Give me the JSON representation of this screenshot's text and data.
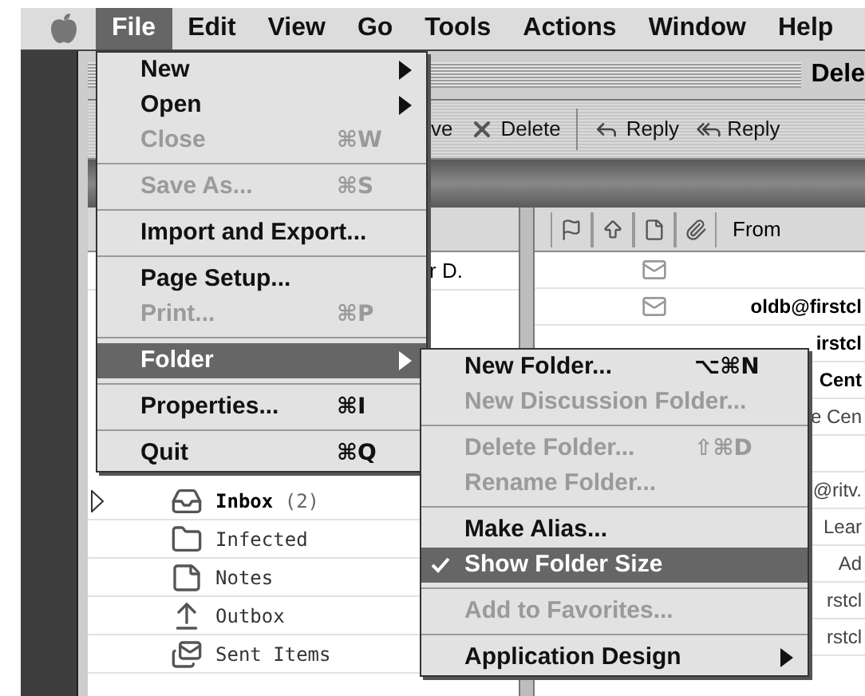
{
  "menubar": {
    "items": [
      {
        "label": "File",
        "selected": true
      },
      {
        "label": "Edit",
        "selected": false
      },
      {
        "label": "View",
        "selected": false
      },
      {
        "label": "Go",
        "selected": false
      },
      {
        "label": "Tools",
        "selected": false
      },
      {
        "label": "Actions",
        "selected": false
      },
      {
        "label": "Window",
        "selected": false
      },
      {
        "label": "Help",
        "selected": false
      }
    ]
  },
  "file_menu": {
    "groups": [
      [
        {
          "label": "New",
          "disabled": false,
          "submenu": true,
          "selected": false
        },
        {
          "label": "Open",
          "disabled": false,
          "submenu": true,
          "selected": false
        },
        {
          "label": "Close",
          "shortcut": "⌘W",
          "disabled": true,
          "submenu": false,
          "selected": false
        }
      ],
      [
        {
          "label": "Save As...",
          "shortcut": "⌘S",
          "disabled": true,
          "submenu": false,
          "selected": false
        }
      ],
      [
        {
          "label": "Import and Export...",
          "disabled": false,
          "submenu": false,
          "selected": false
        }
      ],
      [
        {
          "label": "Page Setup...",
          "disabled": false,
          "submenu": false,
          "selected": false
        },
        {
          "label": "Print...",
          "shortcut": "⌘P",
          "disabled": true,
          "submenu": false,
          "selected": false
        }
      ],
      [
        {
          "label": "Folder",
          "disabled": false,
          "submenu": true,
          "selected": true
        }
      ],
      [
        {
          "label": "Properties...",
          "shortcut": "⌘I",
          "disabled": false,
          "submenu": false,
          "selected": false
        }
      ],
      [
        {
          "label": "Quit",
          "shortcut": "⌘Q",
          "disabled": false,
          "submenu": false,
          "selected": false
        }
      ]
    ]
  },
  "folder_submenu": {
    "groups": [
      [
        {
          "label": "New Folder...",
          "shortcut": "⌥⌘N",
          "disabled": false,
          "submenu": false,
          "selected": false,
          "checked": false
        },
        {
          "label": "New Discussion Folder...",
          "disabled": true,
          "submenu": false,
          "selected": false,
          "checked": false
        }
      ],
      [
        {
          "label": "Delete Folder...",
          "shortcut": "⇧⌘D",
          "disabled": true,
          "submenu": false,
          "selected": false,
          "checked": false
        },
        {
          "label": "Rename Folder...",
          "disabled": true,
          "submenu": false,
          "selected": false,
          "checked": false
        }
      ],
      [
        {
          "label": "Make Alias...",
          "disabled": false,
          "submenu": false,
          "selected": false,
          "checked": false
        },
        {
          "label": "Show Folder Size",
          "disabled": false,
          "submenu": false,
          "selected": true,
          "checked": true
        }
      ],
      [
        {
          "label": "Add to Favorites...",
          "disabled": true,
          "submenu": false,
          "selected": false,
          "checked": false
        }
      ],
      [
        {
          "label": "Application Design",
          "disabled": false,
          "submenu": true,
          "selected": false,
          "checked": false
        }
      ]
    ]
  },
  "window": {
    "title": "Dele",
    "toolbar": [
      {
        "label": "ve",
        "kind": "plain"
      },
      {
        "label": "Delete",
        "kind": "delete"
      },
      {
        "label": "Reply",
        "kind": "reply"
      },
      {
        "label": "Reply",
        "kind": "reply_all"
      }
    ],
    "folder_list": {
      "top_row_text": "r D.",
      "items": [
        {
          "label": "Inbox",
          "count": "(2)",
          "unread": true,
          "has_children": true
        },
        {
          "label": "Infected",
          "unread": false,
          "has_children": false
        },
        {
          "label": "Notes",
          "unread": false,
          "has_children": false
        },
        {
          "label": "Outbox",
          "unread": false,
          "has_children": false
        },
        {
          "label": "Sent Items",
          "unread": false,
          "has_children": false
        }
      ]
    },
    "message_list": {
      "from_header": "From",
      "rows": [
        {
          "envelope": true
        },
        {
          "from": "oldb@firstcl",
          "envelope": true,
          "unread": true
        },
        {
          "from": "irstcl",
          "unread": true
        },
        {
          "from": "Cent",
          "unread": true
        },
        {
          "from": "e Cen",
          "unread": false
        },
        {},
        {
          "from": "@ritv.",
          "unread": false
        },
        {
          "from": "Lear",
          "unread": false
        },
        {
          "from": "Ad",
          "unread": false
        },
        {
          "from": "rstcl",
          "unread": false
        },
        {
          "from": "rstcl",
          "unread": false
        }
      ]
    }
  }
}
